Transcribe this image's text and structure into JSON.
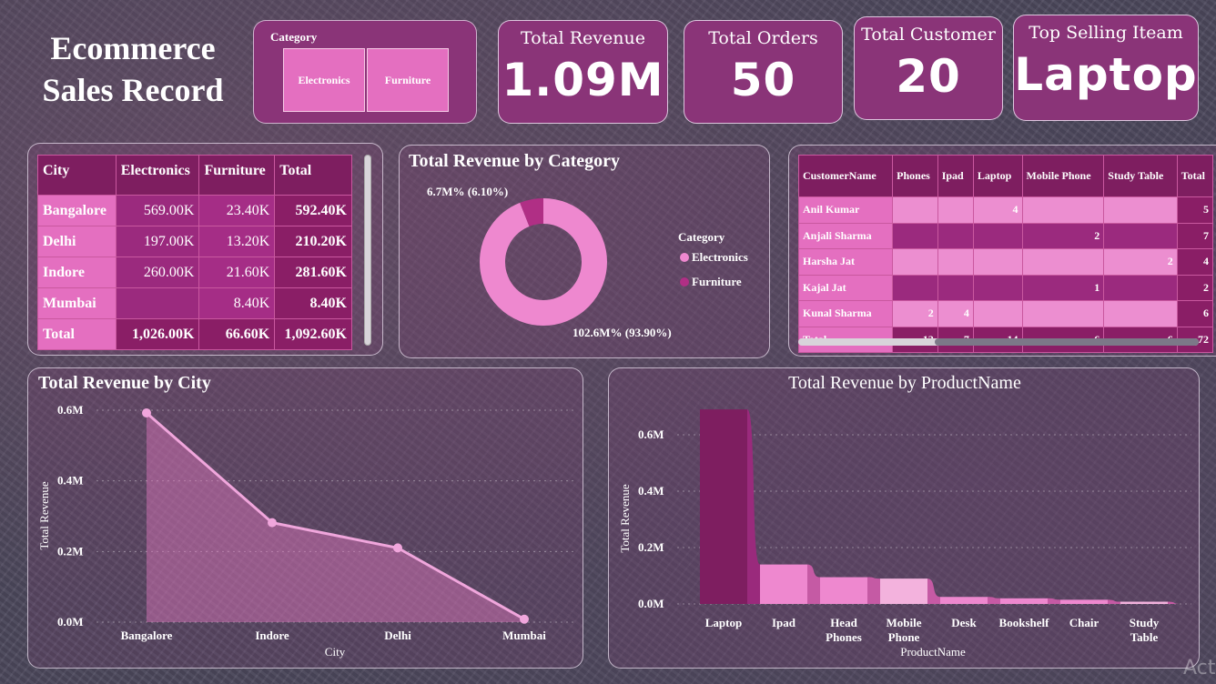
{
  "title_line1": "Ecommerce",
  "title_line2": "Sales Record",
  "slicer": {
    "label": "Category",
    "options": [
      "Electronics",
      "Furniture"
    ]
  },
  "kpis": {
    "revenue": {
      "label": "Total Revenue",
      "value": "1.09M"
    },
    "orders": {
      "label": "Total Orders",
      "value": "50"
    },
    "customers": {
      "label": "Total Customer",
      "value": "20"
    },
    "top": {
      "label": "Top Selling Iteam",
      "value": "Laptop"
    }
  },
  "city_table": {
    "headers": [
      "City",
      "Electronics",
      "Furniture",
      "Total"
    ],
    "rows": [
      [
        "Bangalore",
        "569.00K",
        "23.40K",
        "592.40K"
      ],
      [
        "Delhi",
        "197.00K",
        "13.20K",
        "210.20K"
      ],
      [
        "Indore",
        "260.00K",
        "21.60K",
        "281.60K"
      ],
      [
        "Mumbai",
        "",
        "8.40K",
        "8.40K"
      ],
      [
        "Total",
        "1,026.00K",
        "66.60K",
        "1,092.60K"
      ]
    ]
  },
  "donut": {
    "title": "Total Revenue by Category",
    "legend_title": "Category",
    "legend": [
      "Electronics",
      "Furniture"
    ],
    "label_small": "6.7M% (6.10%)",
    "label_big": "102.6M% (93.90%)",
    "colors": {
      "electronics": "#ee88cf",
      "furniture": "#b02f85"
    }
  },
  "matrix": {
    "headers": [
      "CustomerName",
      "Phones",
      "Ipad",
      "Laptop",
      "Mobile Phone",
      "Study Table",
      "Total"
    ],
    "rows": [
      [
        "Anil Kumar",
        "",
        "",
        "4",
        "",
        "",
        "5"
      ],
      [
        "Anjali Sharma",
        "",
        "",
        "",
        "2",
        "",
        "7"
      ],
      [
        "Harsha Jat",
        "",
        "",
        "",
        "",
        "2",
        "4"
      ],
      [
        "Kajal Jat",
        "",
        "",
        "",
        "1",
        "",
        "2"
      ],
      [
        "Kunal Sharma",
        "2",
        "4",
        "",
        "",
        "",
        "6"
      ],
      [
        "Total",
        "12",
        "7",
        "14",
        "6",
        "6",
        "72"
      ]
    ]
  },
  "chart_data": [
    {
      "type": "area",
      "title": "Total Revenue by City",
      "xlabel": "City",
      "ylabel": "Total Revenue",
      "categories": [
        "Bangalore",
        "Indore",
        "Delhi",
        "Mumbai"
      ],
      "values": [
        0.5924,
        0.2816,
        0.2102,
        0.0084
      ],
      "ylim": [
        0,
        0.6
      ],
      "yticks": [
        "0.0M",
        "0.2M",
        "0.4M",
        "0.6M"
      ],
      "color": "#f0a6dc"
    },
    {
      "type": "bar",
      "title": "Total Revenue by ProductName",
      "xlabel": "ProductName",
      "ylabel": "Total Revenue",
      "categories": [
        "Laptop",
        "Ipad",
        "Head Phones",
        "Mobile Phone",
        "Desk",
        "Bookshelf",
        "Chair",
        "Study Table"
      ],
      "values": [
        0.69,
        0.14,
        0.095,
        0.09,
        0.025,
        0.02,
        0.015,
        0.008
      ],
      "ylim": [
        0,
        0.7
      ],
      "yticks": [
        "0.0M",
        "0.2M",
        "0.4M",
        "0.6M"
      ],
      "colors": [
        "#7e1e60",
        "#ee88cf",
        "#ee88cf",
        "#f3b2dd",
        "#ee88cf",
        "#ee88cf",
        "#ee88cf",
        "#f3b2dd"
      ]
    }
  ],
  "watermark": "Act"
}
